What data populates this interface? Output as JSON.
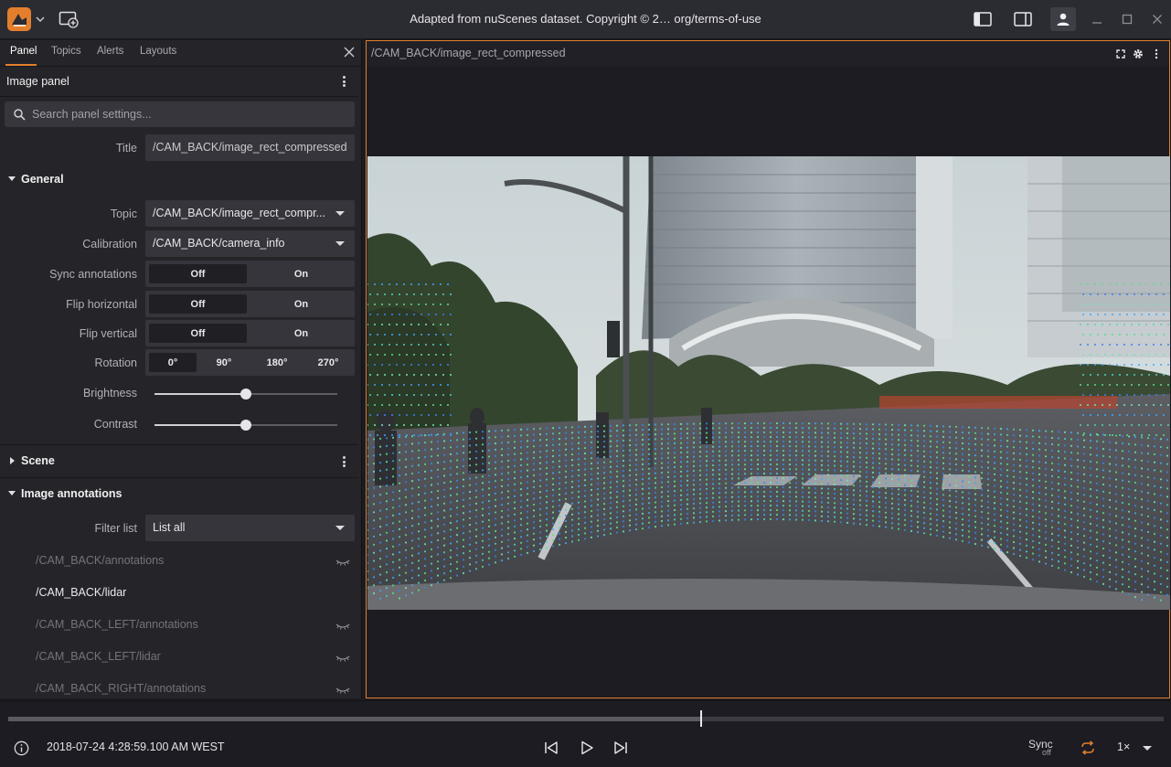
{
  "titlebar": {
    "title": "Adapted from nuScenes dataset. Copyright © 2… org/terms-of-use",
    "icons": [
      "app-logo-icon",
      "chevron-down-icon",
      "add-panel-icon",
      "left-sidebar-toggle-icon",
      "right-sidebar-toggle-icon",
      "user-icon",
      "minimize-icon",
      "maximize-icon",
      "close-icon"
    ],
    "accent": "#e37f2c"
  },
  "sidebar": {
    "tabs": [
      {
        "label": "Panel",
        "active": true
      },
      {
        "label": "Topics",
        "active": false
      },
      {
        "label": "Alerts",
        "active": false
      },
      {
        "label": "Layouts",
        "active": false
      }
    ],
    "panel_title": "Image panel",
    "search_placeholder": "Search panel settings...",
    "title_label": "Title",
    "title_value": "/CAM_BACK/image_rect_compressed",
    "general": {
      "header": "General",
      "topic_label": "Topic",
      "topic_value": "/CAM_BACK/image_rect_compr...",
      "calibration_label": "Calibration",
      "calibration_value": "/CAM_BACK/camera_info",
      "sync_label": "Sync annotations",
      "flip_h_label": "Flip horizontal",
      "flip_v_label": "Flip vertical",
      "off_label": "Off",
      "on_label": "On",
      "sync_selected": "Off",
      "flip_h_selected": "Off",
      "flip_v_selected": "Off",
      "rotation_label": "Rotation",
      "rotation_options": [
        "0°",
        "90°",
        "180°",
        "270°"
      ],
      "rotation_selected": "0°",
      "brightness_label": "Brightness",
      "brightness_level": 0.5,
      "contrast_label": "Contrast",
      "contrast_level": 0.5
    },
    "scene": {
      "header": "Scene"
    },
    "image_annotations": {
      "header": "Image annotations",
      "filter_label": "Filter list",
      "filter_value": "List all",
      "items": [
        {
          "label": "/CAM_BACK/annotations",
          "visible": false
        },
        {
          "label": "/CAM_BACK/lidar",
          "visible": true
        },
        {
          "label": "/CAM_BACK_LEFT/annotations",
          "visible": false
        },
        {
          "label": "/CAM_BACK_LEFT/lidar",
          "visible": false
        },
        {
          "label": "/CAM_BACK_RIGHT/annotations",
          "visible": false
        }
      ]
    }
  },
  "image_panel": {
    "title": "/CAM_BACK/image_rect_compressed",
    "icons": [
      "fullscreen-icon",
      "settings-icon",
      "more-icon"
    ]
  },
  "playback": {
    "timestamp": "2018-07-24 4:28:59.100 AM WEST",
    "progress": 0.6,
    "sync_label": "Sync",
    "sync_state": "off",
    "speed": "1×"
  }
}
